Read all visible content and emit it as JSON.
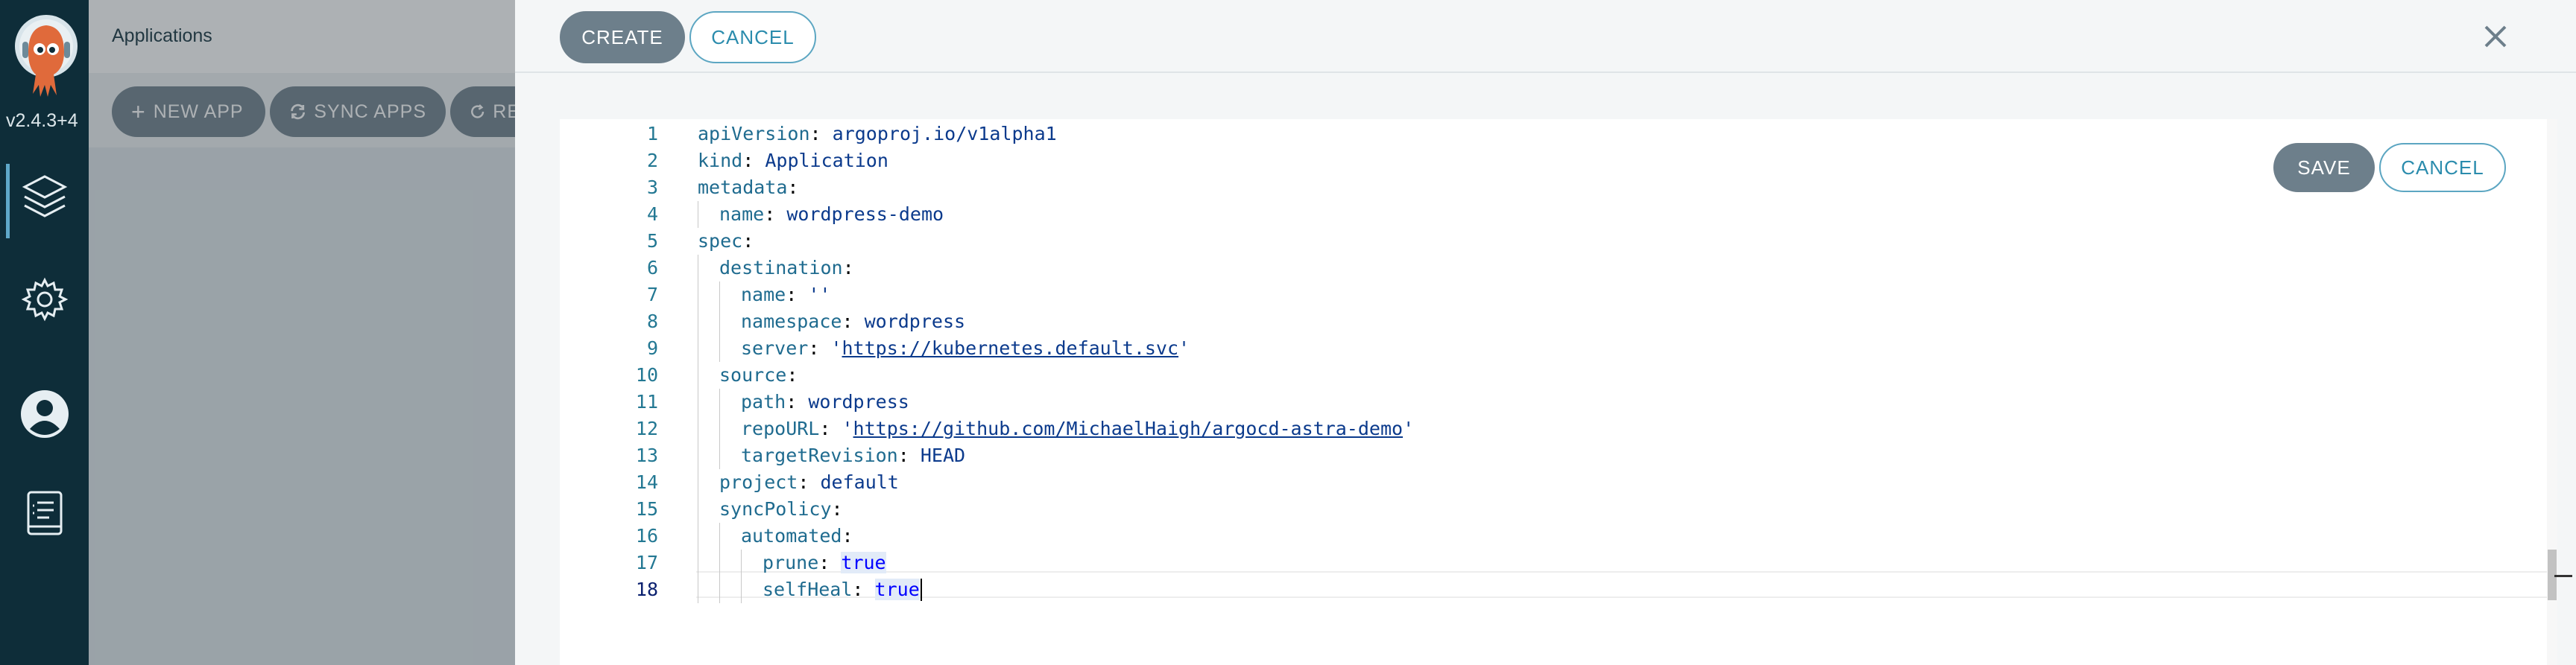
{
  "sidebar": {
    "version": "v2.4.3+4",
    "items": [
      {
        "icon": "layers-icon",
        "active": true
      },
      {
        "icon": "gear-icon",
        "active": false
      },
      {
        "icon": "user-icon",
        "active": false
      },
      {
        "icon": "docs-icon",
        "active": false
      }
    ]
  },
  "page": {
    "title": "Applications",
    "toolbar": {
      "new_app": "NEW APP",
      "sync_apps": "SYNC APPS",
      "refresh_apps": "RE"
    }
  },
  "panel": {
    "create_label": "CREATE",
    "cancel_label": "CANCEL",
    "close_icon": "close-icon",
    "editor": {
      "save_label": "SAVE",
      "cancel_label": "CANCEL",
      "current_line": 18,
      "lines": [
        {
          "num": "1",
          "indent": 0,
          "key": "apiVersion",
          "value": "argoproj.io/v1alpha1",
          "vtype": "plain"
        },
        {
          "num": "2",
          "indent": 0,
          "key": "kind",
          "value": "Application",
          "vtype": "plain"
        },
        {
          "num": "3",
          "indent": 0,
          "key": "metadata",
          "value": "",
          "vtype": "none"
        },
        {
          "num": "4",
          "indent": 1,
          "key": "name",
          "value": "wordpress-demo",
          "vtype": "plain"
        },
        {
          "num": "5",
          "indent": 0,
          "key": "spec",
          "value": "",
          "vtype": "none"
        },
        {
          "num": "6",
          "indent": 1,
          "key": "destination",
          "value": "",
          "vtype": "none"
        },
        {
          "num": "7",
          "indent": 2,
          "key": "name",
          "value": "''",
          "vtype": "plain"
        },
        {
          "num": "8",
          "indent": 2,
          "key": "namespace",
          "value": "wordpress",
          "vtype": "plain"
        },
        {
          "num": "9",
          "indent": 2,
          "key": "server",
          "value": "https://kubernetes.default.svc",
          "vtype": "link"
        },
        {
          "num": "10",
          "indent": 1,
          "key": "source",
          "value": "",
          "vtype": "none"
        },
        {
          "num": "11",
          "indent": 2,
          "key": "path",
          "value": "wordpress",
          "vtype": "plain"
        },
        {
          "num": "12",
          "indent": 2,
          "key": "repoURL",
          "value": "https://github.com/MichaelHaigh/argocd-astra-demo",
          "vtype": "link"
        },
        {
          "num": "13",
          "indent": 2,
          "key": "targetRevision",
          "value": "HEAD",
          "vtype": "plain"
        },
        {
          "num": "14",
          "indent": 1,
          "key": "project",
          "value": "default",
          "vtype": "plain"
        },
        {
          "num": "15",
          "indent": 1,
          "key": "syncPolicy",
          "value": "",
          "vtype": "none"
        },
        {
          "num": "16",
          "indent": 2,
          "key": "automated",
          "value": "",
          "vtype": "none"
        },
        {
          "num": "17",
          "indent": 3,
          "key": "prune",
          "value": "true",
          "vtype": "keyword"
        },
        {
          "num": "18",
          "indent": 3,
          "key": "selfHeal",
          "value": "true",
          "vtype": "keyword"
        }
      ]
    }
  },
  "colors": {
    "sidebar_bg": "#0e2d39",
    "primary_button": "#6d7f8b",
    "accent": "#2b8cad",
    "line_number": "#237893"
  }
}
